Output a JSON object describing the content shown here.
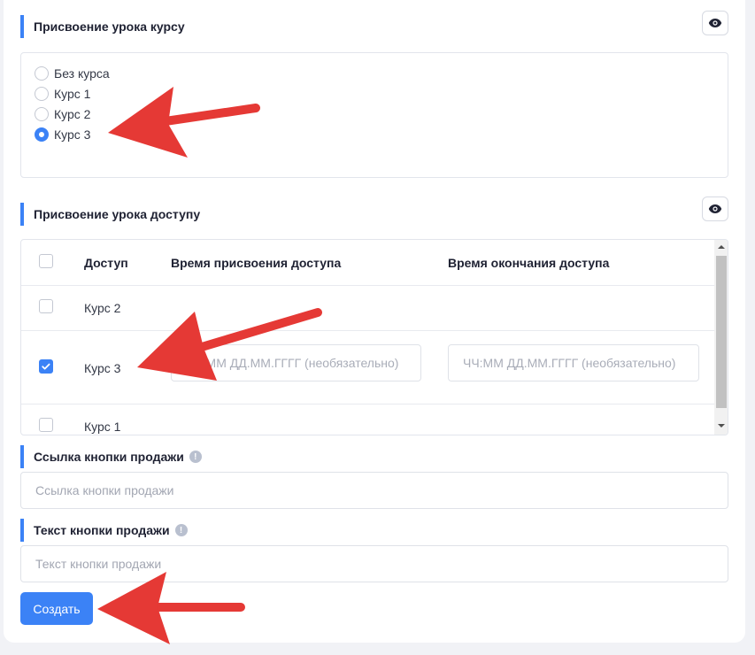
{
  "course_section": {
    "title": "Присвоение урока курсу",
    "options": [
      {
        "label": "Без курса",
        "selected": false
      },
      {
        "label": "Курс 1",
        "selected": false
      },
      {
        "label": "Курс 2",
        "selected": false
      },
      {
        "label": "Курс 3",
        "selected": true
      }
    ]
  },
  "access_section": {
    "title": "Присвоение урока доступу",
    "columns": {
      "access": "Доступ",
      "assign_time": "Время присвоения доступа",
      "end_time": "Время окончания доступа"
    },
    "rows": [
      {
        "label": "Курс 2",
        "checked": false
      },
      {
        "label": "Курс 3",
        "checked": true,
        "assign_placeholder": "ЧЧ:ММ ДД.ММ.ГГГГ (необязательно)",
        "end_placeholder": "ЧЧ:ММ ДД.ММ.ГГГГ (необязательно)"
      },
      {
        "label": "Курс 1",
        "checked": false
      }
    ]
  },
  "sale_link": {
    "title": "Ссылка кнопки продажи",
    "placeholder": "Ссылка кнопки продажи"
  },
  "sale_text": {
    "title": "Текст кнопки продажи",
    "placeholder": "Текст кнопки продажи"
  },
  "create_button": "Создать",
  "colors": {
    "accent": "#3b82f6",
    "annotation_arrow": "#e53935"
  }
}
